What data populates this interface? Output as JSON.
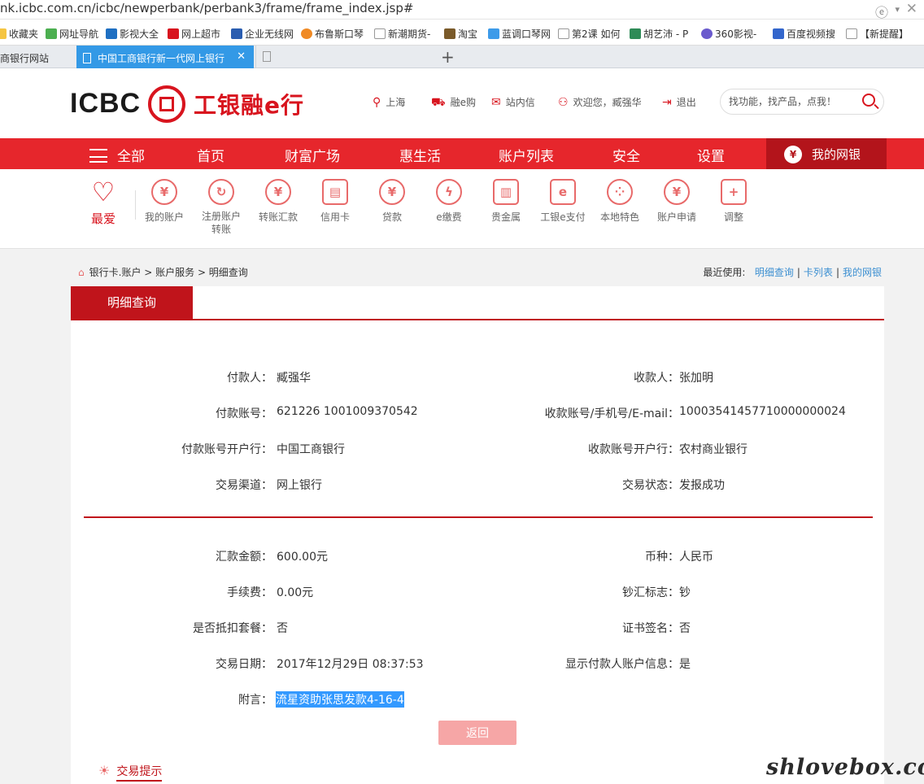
{
  "browser": {
    "url": "nk.icbc.com.cn/icbc/newperbank/perbank3/frame/frame_index.jsp#",
    "bookmarks": [
      {
        "label": "收藏夹",
        "color": "#f5c542"
      },
      {
        "label": "网址导航",
        "color": "#4caf50"
      },
      {
        "label": "影视大全",
        "color": "#1e6fc2"
      },
      {
        "label": "网上超市",
        "color": "#d8141e"
      },
      {
        "label": "企业无线网",
        "color": "#2a5db0"
      },
      {
        "label": "布鲁斯口琴",
        "color": "#f08a24"
      },
      {
        "label": "新潮期货-",
        "color": "#999999"
      },
      {
        "label": "淘宝",
        "color": "#7a5a2a"
      },
      {
        "label": "蓝调口琴网",
        "color": "#3d9be9"
      },
      {
        "label": "第2课 如何",
        "color": "#999999"
      },
      {
        "label": "胡艺沛 - P",
        "color": "#2e8b57"
      },
      {
        "label": "360影视-",
        "color": "#6a5acd"
      },
      {
        "label": "百度视频搜",
        "color": "#3366cc"
      },
      {
        "label": "【新提醒】",
        "color": "#999999"
      }
    ],
    "tabs": [
      {
        "label": "商银行网站"
      },
      {
        "label": "中国工商银行新一代网上银行"
      },
      {
        "label": ""
      }
    ],
    "new_tab": "+"
  },
  "header": {
    "logo_en": "ICBC",
    "logo_cn": "工银融e行",
    "links": {
      "city": "上海",
      "shop": "融e购",
      "mail": "站内信",
      "welcome": "欢迎您，臧强华",
      "logout": "退出"
    },
    "search_placeholder": "找功能，找产品，点我！"
  },
  "nav": {
    "all": "全部",
    "items": [
      "首页",
      "财富广场",
      "惠生活",
      "账户列表",
      "安全",
      "设置"
    ],
    "mybank": "我的网银"
  },
  "quick": {
    "favorite": "最爱",
    "items": [
      {
        "label": "我的账户",
        "icon": "¥"
      },
      {
        "label": "注册账户转账",
        "icon": "↻"
      },
      {
        "label": "转账汇款",
        "icon": "¥"
      },
      {
        "label": "信用卡",
        "icon": "▤"
      },
      {
        "label": "贷款",
        "icon": "¥"
      },
      {
        "label": "e缴费",
        "icon": "ϟ"
      },
      {
        "label": "贵金属",
        "icon": "▥"
      },
      {
        "label": "工银e支付",
        "icon": "e"
      },
      {
        "label": "本地特色",
        "icon": "⁘"
      },
      {
        "label": "账户申请",
        "icon": "¥"
      },
      {
        "label": "调整",
        "icon": "+"
      }
    ]
  },
  "breadcrumb": {
    "path": "银行卡.账户 > 账户服务 > 明细查询",
    "recent_label": "最近使用:",
    "recent_links": [
      "明细查询",
      "卡列表",
      "我的网银"
    ]
  },
  "detail": {
    "tab": "明细查询",
    "section1": [
      {
        "left_label": "付款人：",
        "left_value": "臧强华",
        "right_label": "收款人：",
        "right_value": "张加明"
      },
      {
        "left_label": "付款账号：",
        "left_value": "621226 1001009370542",
        "right_label": "收款账号/手机号/E-mail：",
        "right_value": "10003541457710000000024"
      },
      {
        "left_label": "付款账号开户行：",
        "left_value": "中国工商银行",
        "right_label": "收款账号开户行：",
        "right_value": "农村商业银行"
      },
      {
        "left_label": "交易渠道：",
        "left_value": "网上银行",
        "right_label": "交易状态：",
        "right_value": "发报成功"
      }
    ],
    "section2": [
      {
        "left_label": "汇款金额：",
        "left_value": "600.00元",
        "right_label": "币种：",
        "right_value": "人民币"
      },
      {
        "left_label": "手续费：",
        "left_value": "0.00元",
        "right_label": "钞汇标志：",
        "right_value": "钞"
      },
      {
        "left_label": "是否抵扣套餐：",
        "left_value": "否",
        "right_label": "证书签名：",
        "right_value": "否"
      },
      {
        "left_label": "交易日期：",
        "left_value": "2017年12月29日 08:37:53",
        "right_label": "显示付款人账户信息：",
        "right_value": "是"
      }
    ],
    "memo_label": "附言：",
    "memo_value": "流星资助张思发款4-16-4",
    "back_button": "返回",
    "tip": "交易提示"
  },
  "watermark": "shlovebox.com"
}
